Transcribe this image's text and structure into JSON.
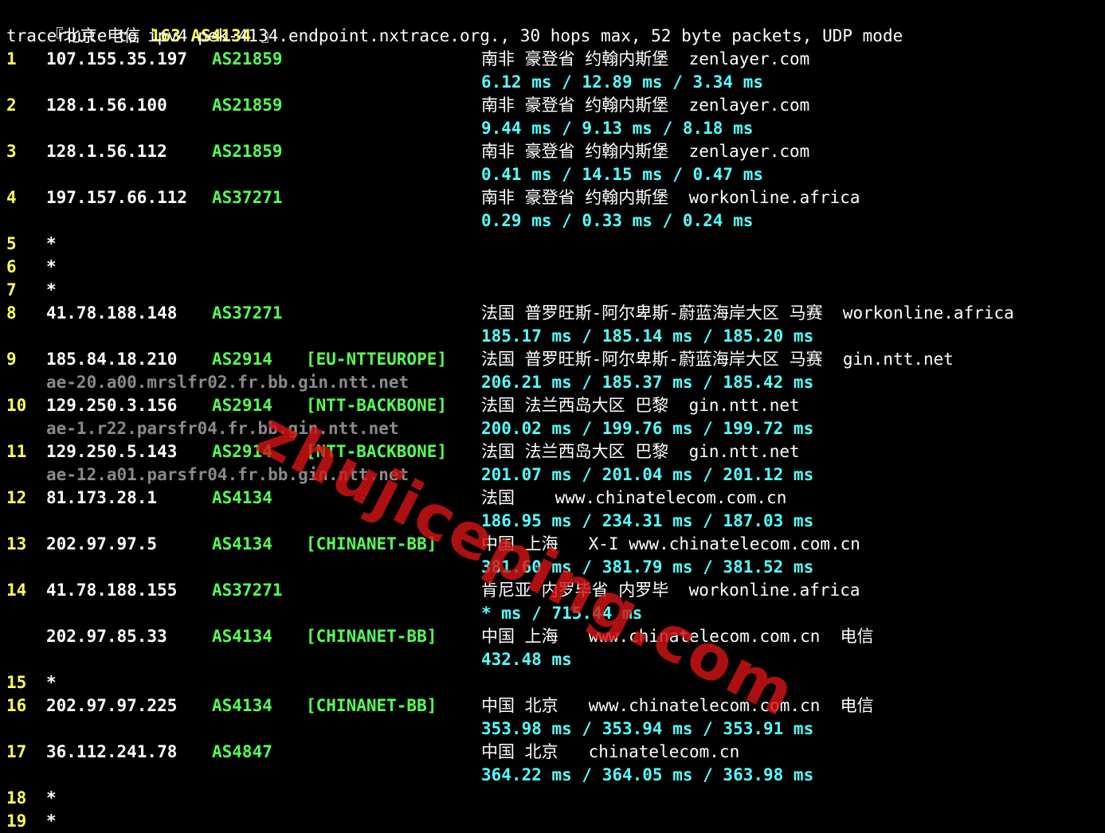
{
  "header": {
    "title": "『北京 电信 163 AS4134 』",
    "title_parts": [
      "『北京 电信 ",
      "163 AS4134",
      " 』"
    ],
    "command": "traceroute to ipv4.pek-4134.endpoint.nxtrace.org., 30 hops max, 52 byte packets, UDP mode"
  },
  "hops": [
    {
      "hop": "1",
      "ip": "107.155.35.197",
      "asn": "AS21859",
      "tag": "",
      "rdns": "",
      "geo": "南非 豪登省 约翰内斯堡  zenlayer.com",
      "rtt": "6.12 ms / 12.89 ms / 3.34 ms"
    },
    {
      "hop": "2",
      "ip": "128.1.56.100",
      "asn": "AS21859",
      "tag": "",
      "rdns": "",
      "geo": "南非 豪登省 约翰内斯堡  zenlayer.com",
      "rtt": "9.44 ms / 9.13 ms / 8.18 ms"
    },
    {
      "hop": "3",
      "ip": "128.1.56.112",
      "asn": "AS21859",
      "tag": "",
      "rdns": "",
      "geo": "南非 豪登省 约翰内斯堡  zenlayer.com",
      "rtt": "0.41 ms / 14.15 ms / 0.47 ms"
    },
    {
      "hop": "4",
      "ip": "197.157.66.112",
      "asn": "AS37271",
      "tag": "",
      "rdns": "",
      "geo": "南非 豪登省 约翰内斯堡  workonline.africa",
      "rtt": "0.29 ms / 0.33 ms / 0.24 ms"
    },
    {
      "hop": "5",
      "ip": "*",
      "asn": "",
      "tag": "",
      "rdns": "",
      "geo": "",
      "rtt": ""
    },
    {
      "hop": "6",
      "ip": "*",
      "asn": "",
      "tag": "",
      "rdns": "",
      "geo": "",
      "rtt": ""
    },
    {
      "hop": "7",
      "ip": "*",
      "asn": "",
      "tag": "",
      "rdns": "",
      "geo": "",
      "rtt": ""
    },
    {
      "hop": "8",
      "ip": "41.78.188.148",
      "asn": "AS37271",
      "tag": "",
      "rdns": "",
      "geo": "法国 普罗旺斯-阿尔卑斯-蔚蓝海岸大区 马赛  workonline.africa",
      "rtt": "185.17 ms / 185.14 ms / 185.20 ms"
    },
    {
      "hop": "9",
      "ip": "185.84.18.210",
      "asn": "AS2914",
      "tag": "[EU-NTTEUROPE]",
      "rdns": "ae-20.a00.mrslfr02.fr.bb.gin.ntt.net",
      "geo": "法国 普罗旺斯-阿尔卑斯-蔚蓝海岸大区 马赛  gin.ntt.net",
      "rtt": "206.21 ms / 185.37 ms / 185.42 ms"
    },
    {
      "hop": "10",
      "ip": "129.250.3.156",
      "asn": "AS2914",
      "tag": "[NTT-BACKBONE]",
      "rdns": "ae-1.r22.parsfr04.fr.bb.gin.ntt.net",
      "geo": "法国 法兰西岛大区 巴黎  gin.ntt.net",
      "rtt": "200.02 ms / 199.76 ms / 199.72 ms"
    },
    {
      "hop": "11",
      "ip": "129.250.5.143",
      "asn": "AS2914",
      "tag": "[NTT-BACKBONE]",
      "rdns": "ae-12.a01.parsfr04.fr.bb.gin.ntt.net",
      "geo": "法国 法兰西岛大区 巴黎  gin.ntt.net",
      "rtt": "201.07 ms / 201.04 ms / 201.12 ms"
    },
    {
      "hop": "12",
      "ip": "81.173.28.1",
      "asn": "AS4134",
      "tag": "",
      "rdns": "",
      "geo": "法国    www.chinatelecom.com.cn",
      "rtt": "186.95 ms / 234.31 ms / 187.03 ms"
    },
    {
      "hop": "13",
      "ip": "202.97.97.5",
      "asn": "AS4134",
      "tag": "[CHINANET-BB]",
      "rdns": "",
      "geo": "中国 上海   X-I www.chinatelecom.com.cn",
      "rtt": "381.60 ms / 381.79 ms / 381.52 ms"
    },
    {
      "hop": "14",
      "ip": "41.78.188.155",
      "asn": "AS37271",
      "tag": "",
      "rdns": "",
      "geo": "肯尼亚 内罗毕省 内罗毕  workonline.africa",
      "rtt": "* ms / 715.44 ms"
    },
    {
      "hop": "",
      "ip": "202.97.85.33",
      "asn": "AS4134",
      "tag": "[CHINANET-BB]",
      "rdns": "",
      "geo": "中国 上海   www.chinatelecom.com.cn  电信",
      "rtt": "432.48 ms"
    },
    {
      "hop": "15",
      "ip": "*",
      "asn": "",
      "tag": "",
      "rdns": "",
      "geo": "",
      "rtt": ""
    },
    {
      "hop": "16",
      "ip": "202.97.97.225",
      "asn": "AS4134",
      "tag": "[CHINANET-BB]",
      "rdns": "",
      "geo": "中国 北京   www.chinatelecom.com.cn  电信",
      "rtt": "353.98 ms / 353.94 ms / 353.91 ms"
    },
    {
      "hop": "17",
      "ip": "36.112.241.78",
      "asn": "AS4847",
      "tag": "",
      "rdns": "",
      "geo": "中国 北京   chinatelecom.cn",
      "rtt": "364.22 ms / 364.05 ms / 363.98 ms"
    },
    {
      "hop": "18",
      "ip": "*",
      "asn": "",
      "tag": "",
      "rdns": "",
      "geo": "",
      "rtt": ""
    },
    {
      "hop": "19",
      "ip": "*",
      "asn": "",
      "tag": "",
      "rdns": "",
      "geo": "",
      "rtt": ""
    }
  ],
  "watermark": "zhujiceping.com",
  "colors": {
    "hop": "#ffff55",
    "ip": "#ffffff",
    "asn": "#55ff55",
    "rtt": "#55ffff",
    "rdns": "#8a8a8a",
    "background": "#000000"
  }
}
